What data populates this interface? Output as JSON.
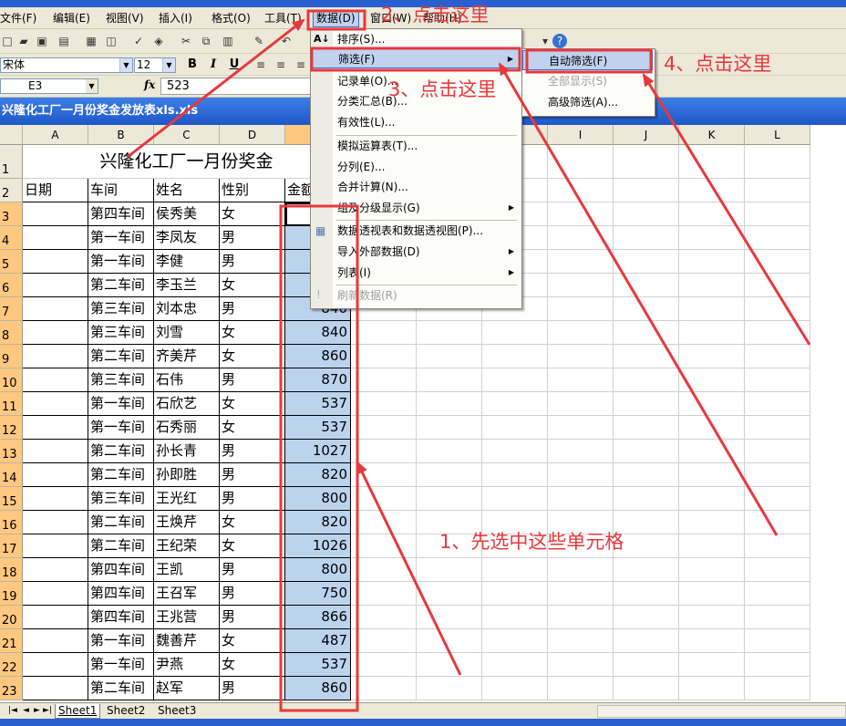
{
  "menubar": {
    "items": [
      "文件(F)",
      "编辑(E)",
      "视图(V)",
      "插入(I)",
      "格式(O)",
      "工具(T)",
      "数据(D)",
      "窗口(W)",
      "帮助(H)"
    ]
  },
  "toolbar": {
    "font_name": "宋体",
    "font_size": "12",
    "bold": "B",
    "italic": "I",
    "underline": "U"
  },
  "formula_bar": {
    "name_box": "E3",
    "fx": "fx",
    "value": "523"
  },
  "workbook": {
    "title": "兴隆化工厂一月份奖金发放表xls.xls"
  },
  "sheet": {
    "columns": [
      "A",
      "B",
      "C",
      "D",
      "E",
      "F",
      "G",
      "H",
      "I",
      "J",
      "K",
      "L"
    ],
    "row_numbers": [
      "1",
      "2",
      "3",
      "4",
      "5",
      "6",
      "7",
      "8",
      "9",
      "10",
      "11",
      "12",
      "13",
      "14",
      "15",
      "16",
      "17",
      "18",
      "19",
      "20",
      "21",
      "22",
      "23"
    ],
    "title": "兴隆化工厂一月份奖金",
    "headers": [
      "日期",
      "车间",
      "姓名",
      "性别",
      "金额"
    ],
    "rows": [
      [
        "",
        "第四车间",
        "侯秀美",
        "女",
        ""
      ],
      [
        "",
        "第一车间",
        "李凤友",
        "男",
        ""
      ],
      [
        "",
        "第一车间",
        "李健",
        "男",
        ""
      ],
      [
        "",
        "第二车间",
        "李玉兰",
        "女",
        ""
      ],
      [
        "",
        "第三车间",
        "刘本忠",
        "男",
        "840"
      ],
      [
        "",
        "第三车间",
        "刘雪",
        "女",
        "840"
      ],
      [
        "",
        "第二车间",
        "齐美芹",
        "女",
        "860"
      ],
      [
        "",
        "第三车间",
        "石伟",
        "男",
        "870"
      ],
      [
        "",
        "第一车间",
        "石欣艺",
        "女",
        "537"
      ],
      [
        "",
        "第一车间",
        "石秀丽",
        "女",
        "537"
      ],
      [
        "",
        "第二车间",
        "孙长青",
        "男",
        "1027"
      ],
      [
        "",
        "第二车间",
        "孙即胜",
        "男",
        "820"
      ],
      [
        "",
        "第三车间",
        "王光红",
        "男",
        "800"
      ],
      [
        "",
        "第二车间",
        "王焕芹",
        "女",
        "820"
      ],
      [
        "",
        "第二车间",
        "王纪荣",
        "女",
        "1026"
      ],
      [
        "",
        "第四车间",
        "王凯",
        "男",
        "800"
      ],
      [
        "",
        "第四车间",
        "王召军",
        "男",
        "750"
      ],
      [
        "",
        "第四车间",
        "王兆营",
        "男",
        "866"
      ],
      [
        "",
        "第一车间",
        "魏善芹",
        "女",
        "487"
      ],
      [
        "",
        "第一车间",
        "尹燕",
        "女",
        "537"
      ],
      [
        "",
        "第二车间",
        "赵军",
        "男",
        "860"
      ]
    ],
    "tabs": [
      "Sheet1",
      "Sheet2",
      "Sheet3"
    ]
  },
  "data_menu": {
    "items": [
      "排序(S)...",
      "筛选(F)",
      "记录单(O)...",
      "分类汇总(B)...",
      "有效性(L)...",
      "模拟运算表(T)...",
      "分列(E)...",
      "合并计算(N)...",
      "组及分级显示(G)",
      "数据透视表和数据透视图(P)...",
      "导入外部数据(D)",
      "列表(I)",
      "刷新数据(R)"
    ]
  },
  "filter_submenu": {
    "items": [
      "自动筛选(F)",
      "全部显示(S)",
      "高级筛选(A)..."
    ]
  },
  "annotations": {
    "step1": "1、先选中这些单元格",
    "step2": "2、点击这里",
    "step3": "3、点击这里",
    "step4": "4、点击这里"
  },
  "colors": {
    "annotation": "#e8383d",
    "selection": "#bcd3ee",
    "menu_highlight": "#c1d2ee",
    "header_selected": "#ffc880"
  }
}
